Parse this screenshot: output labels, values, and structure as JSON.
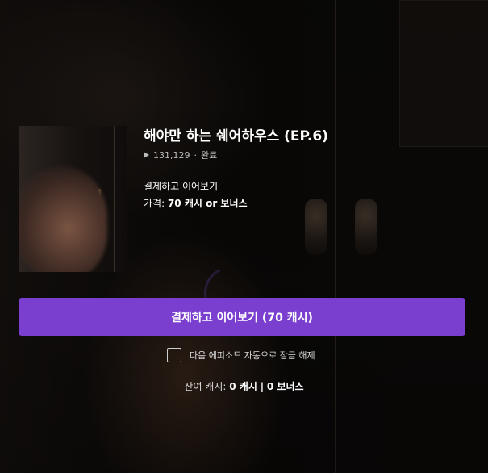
{
  "episode": {
    "title": "해야만 하는 쉐어하우스 (EP.6)",
    "views": "131,129",
    "separator": "·",
    "status": "완료"
  },
  "purchase": {
    "unlock_text": "결제하고 이어보기",
    "price_label": "가격:",
    "price_value": "70 캐시 or 보너스",
    "button_label": "결제하고 이어보기 (70 캐시)"
  },
  "auto_unlock": {
    "label": "다음 에피소드 자동으로 잠금 해제",
    "checked": false
  },
  "balance": {
    "label": "잔여 캐시:",
    "cash": "0 캐시",
    "divider": "|",
    "bonus": "0 보너스"
  },
  "colors": {
    "accent": "#7b3fcf",
    "background": "#0b0908"
  },
  "icons": {
    "play": "play-icon",
    "checkbox": "checkbox-icon"
  }
}
